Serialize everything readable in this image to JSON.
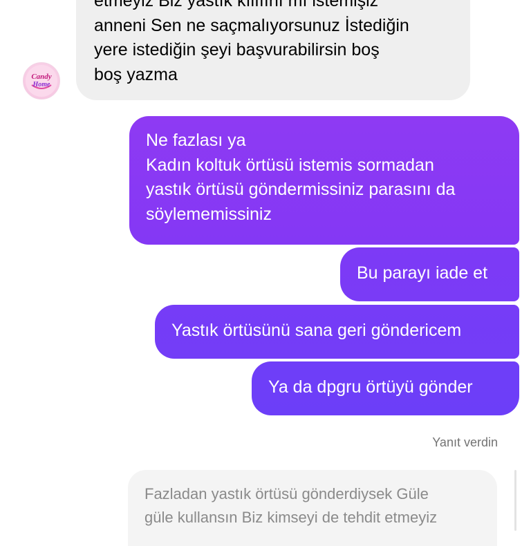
{
  "incoming_message": {
    "lines": [
      "etmeyiz Biz yastık kılıfını mı istemişiz",
      "anneni Sen ne saçmalıyorsunuz İstediğin",
      "yere istediğin şeyi başvurabilirsin boş",
      "boş yazma"
    ]
  },
  "outgoing_messages": [
    {
      "lines": [
        "Ne fazlası ya",
        "Kadın koltuk örtüsü istemis sormadan",
        "yastık örtüsü göndermissiniz parasını da",
        "söylememissiniz"
      ]
    },
    {
      "lines": [
        "Bu parayı iade et"
      ]
    },
    {
      "lines": [
        "Yastık örtüsünü sana geri göndericem"
      ]
    },
    {
      "lines": [
        "Ya da dpgru örtüyü gönder"
      ]
    }
  ],
  "reply_label": "Yanıt verdin",
  "quoted_message": {
    "lines": [
      "Fazladan yastık örtüsü gönderdiysek Güle",
      "güle kullansın Biz kimseyi de tehdit etmeyiz"
    ]
  },
  "avatar": {
    "icon": "shop-logo-icon",
    "logo_text": "Candy Home"
  },
  "colors": {
    "incoming_bubble": "#efefef",
    "outgoing_top": "#8e3af3",
    "outgoing_bottom": "#6c3ef8",
    "reply_label": "#737373",
    "quoted_text": "#8a8a8a"
  }
}
